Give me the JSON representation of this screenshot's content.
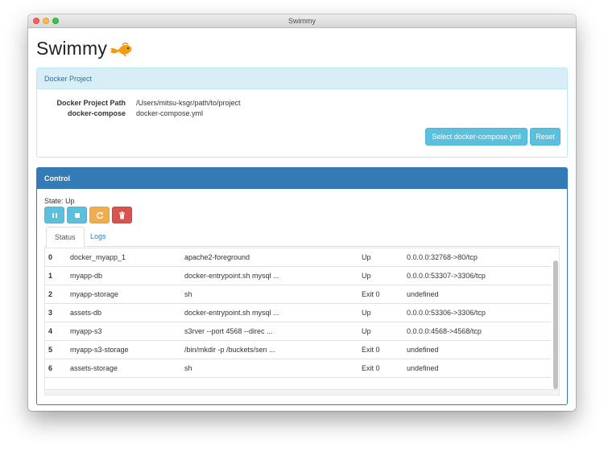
{
  "window": {
    "title": "Swimmy"
  },
  "app": {
    "logo_text": "Swimmy"
  },
  "project_panel": {
    "heading": "Docker Project",
    "path_label": "Docker Project Path",
    "path_value": "/Users/mitsu-ksgr/path/to/project",
    "compose_label": "docker-compose",
    "compose_value": "docker-compose.yml",
    "select_button": "Select docker-compose.yml",
    "reset_button": "Reset"
  },
  "control_panel": {
    "heading": "Control",
    "state_text": "State: Up",
    "buttons": [
      "pause-icon",
      "stop-icon",
      "restart-icon",
      "trash-icon"
    ],
    "tabs": [
      {
        "label": "Status",
        "active": true
      },
      {
        "label": "Logs",
        "active": false
      }
    ]
  },
  "containers": [
    {
      "index": "0",
      "name": "docker_myapp_1",
      "command": "apache2-foreground",
      "state": "Up",
      "ports": "0.0.0.0:32768->80/tcp"
    },
    {
      "index": "1",
      "name": "myapp-db",
      "command": "docker-entrypoint.sh mysql ...",
      "state": "Up",
      "ports": "0.0.0.0:53307->3306/tcp"
    },
    {
      "index": "2",
      "name": "myapp-storage",
      "command": "sh",
      "state": "Exit 0",
      "ports": "undefined"
    },
    {
      "index": "3",
      "name": "assets-db",
      "command": "docker-entrypoint.sh mysql ...",
      "state": "Up",
      "ports": "0.0.0.0:53306->3306/tcp"
    },
    {
      "index": "4",
      "name": "myapp-s3",
      "command": "s3rver --port 4568 --direc ...",
      "state": "Up",
      "ports": "0.0.0.0:4568->4568/tcp"
    },
    {
      "index": "5",
      "name": "myapp-s3-storage",
      "command": "/bin/mkdir -p /buckets/sen ...",
      "state": "Exit 0",
      "ports": "undefined"
    },
    {
      "index": "6",
      "name": "assets-storage",
      "command": "sh",
      "state": "Exit 0",
      "ports": "undefined"
    }
  ],
  "colors": {
    "info_heading_bg": "#d9edf7",
    "primary": "#337ab7",
    "btn_info": "#5bc0de",
    "btn_warning": "#f0ad4e",
    "btn_danger": "#d9534f"
  }
}
